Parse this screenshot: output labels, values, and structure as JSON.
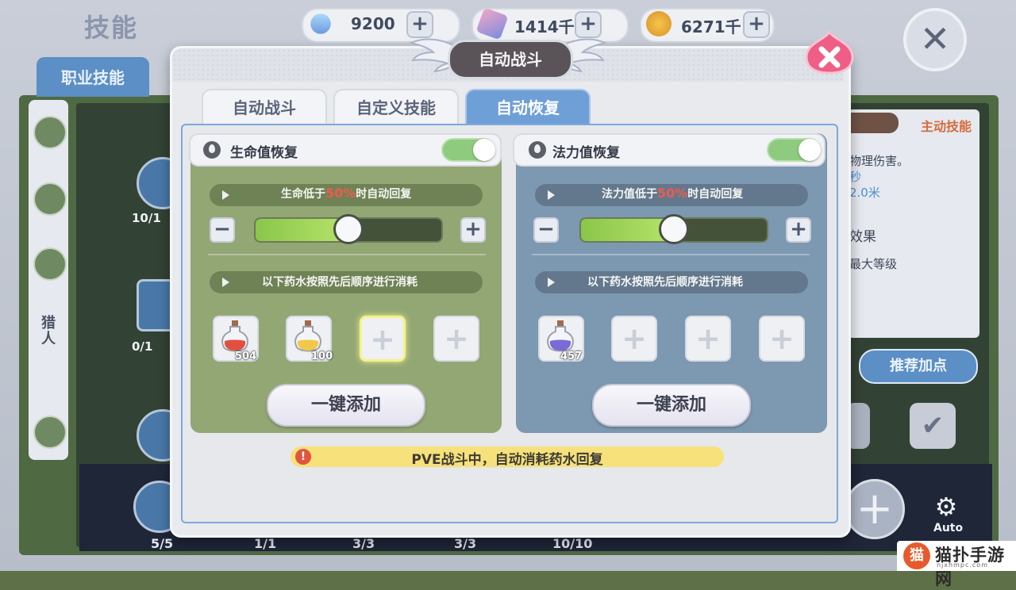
{
  "background": {
    "title": "技能",
    "resources": [
      {
        "icon": "diamond-icon",
        "value": "9200"
      },
      {
        "icon": "crystal-icon",
        "value": "1414千"
      },
      {
        "icon": "coin-icon",
        "value": "6271千"
      }
    ],
    "tab": "职业技能",
    "side_label": "猎人",
    "node_counts": [
      "10/1",
      "0/1"
    ],
    "right_panel": {
      "title": "主动技能",
      "lines": [
        "物理伤害。",
        "秒",
        "2.0米",
        "效果",
        "最大等级"
      ],
      "recommend_label": "推荐加点"
    },
    "auto_label": "Auto",
    "levels": [
      "5/5",
      "1/1",
      "3/3",
      "3/3",
      "10/10"
    ],
    "watermark": {
      "text": "猫扑手游网",
      "url": "njxhmpc.com"
    }
  },
  "dialog": {
    "title": "自动战斗",
    "tabs": [
      {
        "label": "自动战斗",
        "active": false
      },
      {
        "label": "自定义技能",
        "active": false
      },
      {
        "label": "自动恢复",
        "active": true
      }
    ],
    "hp": {
      "title": "生命值恢复",
      "enabled": true,
      "threshold_prefix": "生命低于",
      "threshold_pct": "50%",
      "threshold_suffix": "时自动回复",
      "slider_value": 0.5,
      "order_text": "以下药水按照先后顺序进行消耗",
      "potions": [
        {
          "color": "#e1503e",
          "count": "504"
        },
        {
          "color": "#f0c84a",
          "count": "100"
        }
      ],
      "add_label": "一键添加"
    },
    "mp": {
      "title": "法力值恢复",
      "enabled": true,
      "threshold_prefix": "法力值低于",
      "threshold_pct": "50%",
      "threshold_suffix": "时自动回复",
      "slider_value": 0.5,
      "order_text": "以下药水按照先后顺序进行消耗",
      "potions": [
        {
          "color": "#7a6ad8",
          "count": "457"
        }
      ],
      "add_label": "一键添加"
    },
    "notice": "PVE战斗中，自动消耗药水回复"
  }
}
